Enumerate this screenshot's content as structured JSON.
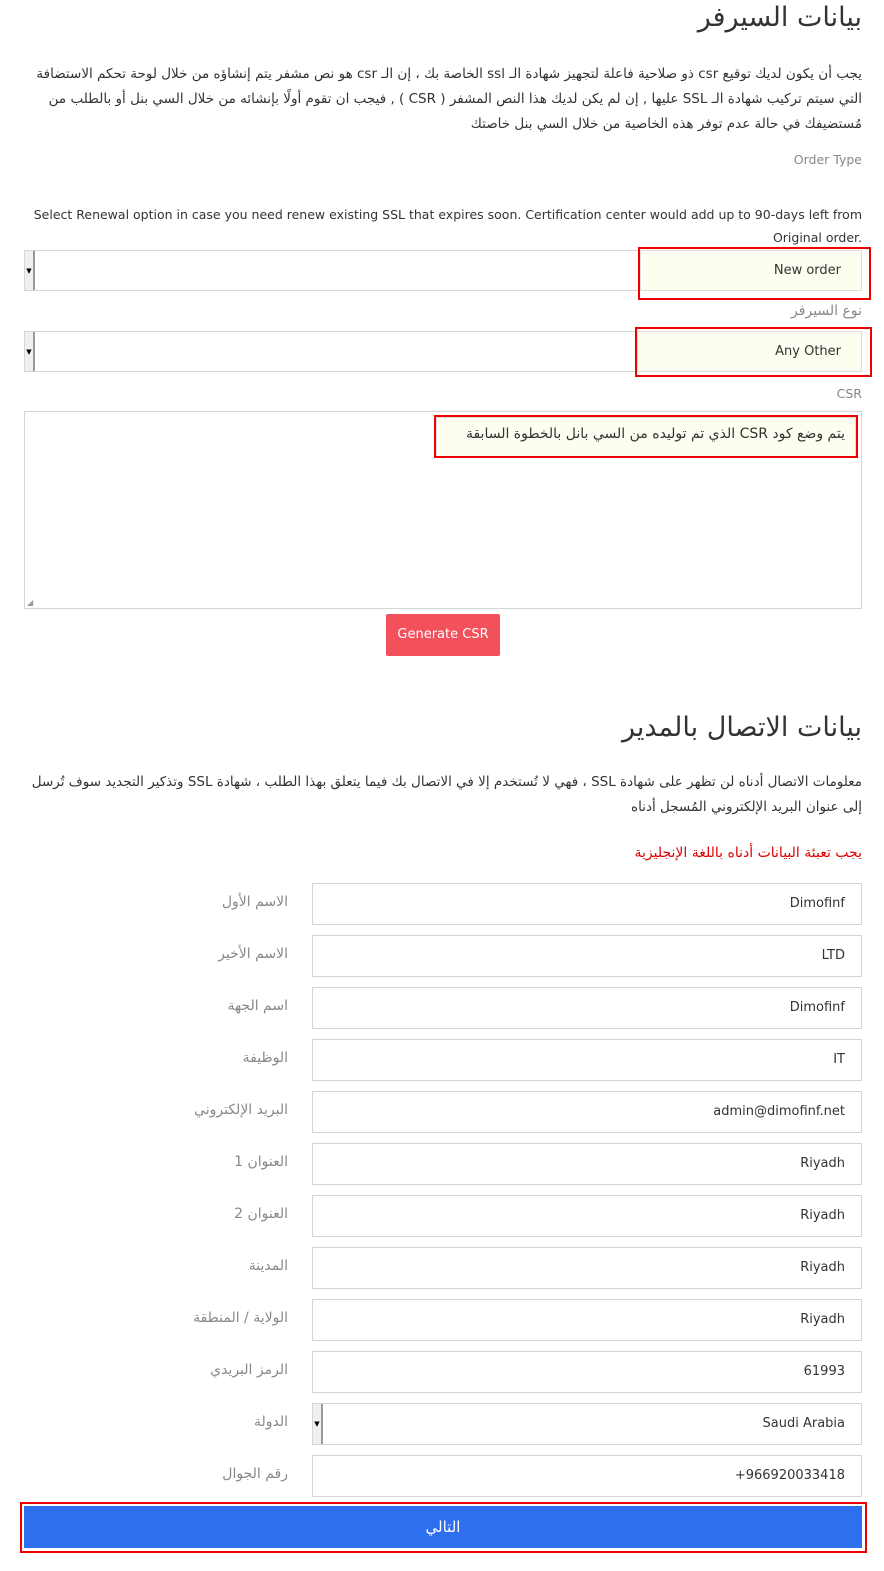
{
  "server": {
    "title": "بيانات السيرفر",
    "description": "يجب أن يكون لديك توقيع csr ذو صلاحية فاعلة لتجهيز شهادة الـ ssl الخاصة بك ، إن الـ csr هو نص مشفر يتم إنشاؤه من خلال لوحة تحكم الاستضافة التي سيتم تركيب شهادة الـ SSL عليها , إن لم يكن لديك هذا النص المشفر ( CSR ) , فيجب ان تقوم أولًا بإنشائه من خلال السي بنل أو بالطلب من مُستضيفك في حالة عدم توفر هذه الخاصية من خلال السي بنل خاصتك",
    "order_type_label": "Order Type",
    "order_type_help": "Select Renewal option in case you need renew existing SSL that expires soon. Certification center would add up to 90-days left from Original order.",
    "order_type_value": "New order",
    "server_type_label": "نوع السيرفر",
    "server_type_value": "Any Other",
    "csr_label": "CSR",
    "csr_placeholder": "يتم وضع كود CSR الذي تم توليده من السي بانل بالخطوة السابقة",
    "generate_csr": "Generate CSR"
  },
  "contact": {
    "title": "بيانات الاتصال بالمدير",
    "description": "معلومات الاتصال أدناه لن تظهر على شهادة SSL ، فهي لا تُستخدم إلا في الاتصال بك فيما يتعلق بهذا الطلب ، شهادة SSL وتذكير التجديد سوف تُرسل إلى عنوان البريد الإلكتروني المُسجل أدناه",
    "warning": "يجب تعبئة البيانات أدناه باللغة الإنجليزية",
    "warning_color": "#e00000",
    "fields": [
      {
        "label": "الاسم الأول",
        "value": "Dimofinf"
      },
      {
        "label": "الاسم الأخير",
        "value": "LTD"
      },
      {
        "label": "اسم الجهة",
        "value": "Dimofinf"
      },
      {
        "label": "الوظيفة",
        "value": "IT"
      },
      {
        "label": "البريد الإلكتروني",
        "value": "admin@dimofinf.net"
      },
      {
        "label": "العنوان 1",
        "value": "Riyadh"
      },
      {
        "label": "العنوان 2",
        "value": "Riyadh"
      },
      {
        "label": "المدينة",
        "value": "Riyadh"
      },
      {
        "label": "الولاية / المنطقة",
        "value": "Riyadh"
      },
      {
        "label": "الرمز البريدي",
        "value": "61993"
      },
      {
        "label": "الدولة",
        "value": "Saudi Arabia"
      },
      {
        "label": "رقم الجوال",
        "value": "+966920033418"
      }
    ],
    "next_button": "التالي"
  }
}
